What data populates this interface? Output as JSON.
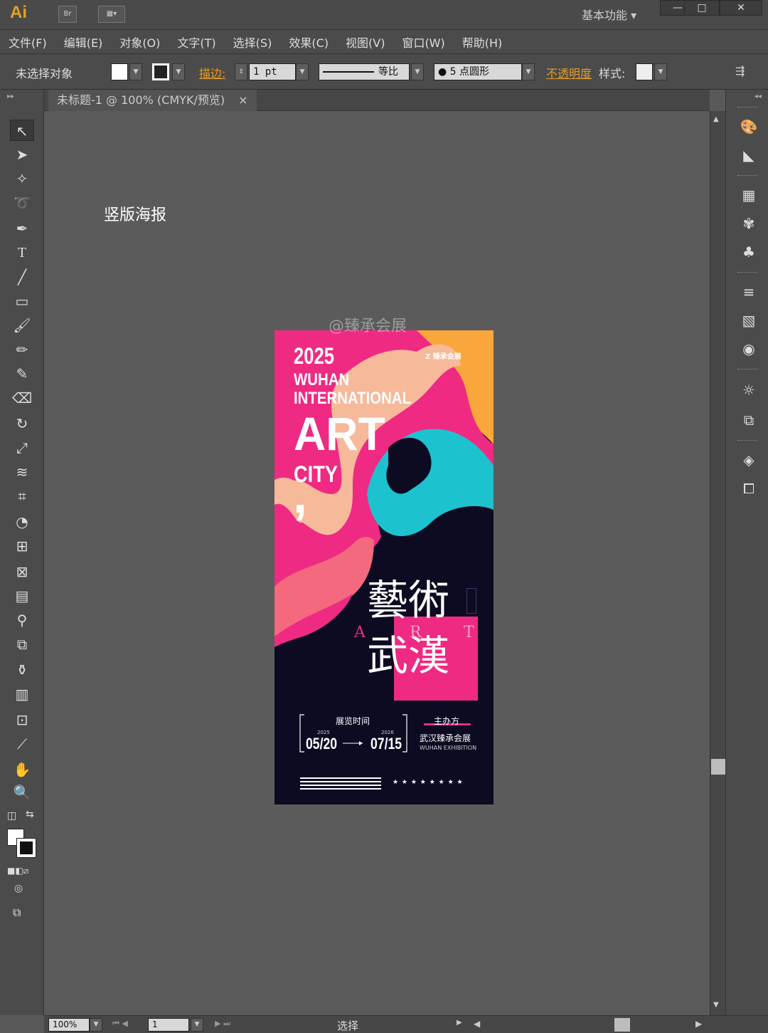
{
  "app": {
    "logo": "Ai",
    "bridge_label": "Br",
    "workspace": "基本功能"
  },
  "window_controls": {
    "minimize": "—",
    "maximize": "□",
    "close": "✕"
  },
  "menu": [
    "文件(F)",
    "编辑(E)",
    "对象(O)",
    "文字(T)",
    "选择(S)",
    "效果(C)",
    "视图(V)",
    "窗口(W)",
    "帮助(H)"
  ],
  "control_bar": {
    "selection": "未选择对象",
    "stroke_label": "描边:",
    "stroke_weight": "1 pt",
    "profile": "等比",
    "brush": "5 点圆形",
    "opacity_label": "不透明度",
    "style_label": "样式:"
  },
  "document_tab": {
    "title": "未标题-1 @ 100% (CMYK/预览)",
    "close": "×"
  },
  "canvas": {
    "label": "竖版海报",
    "watermark": "@臻承会展"
  },
  "poster": {
    "year": "2025",
    "line1": "WUHAN",
    "line2": "INTERNATIONAL",
    "line3": "ART",
    "line4": "CITY",
    "comma": ",",
    "brand": "臻承会展",
    "brand_mark": "Z",
    "cn_line1": "藝術",
    "cn_line2": "武漢",
    "art_letters": [
      "A",
      "R",
      "T"
    ],
    "time_label": "展览时间",
    "start_year": "2025",
    "start_date": "05/20",
    "end_year": "2026",
    "end_date": "07/15",
    "organizer_label": "主办方",
    "organizer_cn": "武汉臻承会展",
    "organizer_en": "WUHAN EXHIBITION",
    "stars": "★ ★ ★ ★ ★ ★ ★ ★",
    "colors": {
      "pink": "#ef2a83",
      "peach": "#f6b99a",
      "orange": "#f9a63a",
      "teal": "#1cc3cf",
      "coral": "#f4697d",
      "navy": "#0c0b22"
    }
  },
  "status": {
    "zoom": "100%",
    "page": "1",
    "mode": "选择"
  },
  "tools_left": [
    "selection-tool-icon",
    "direct-selection-icon",
    "magic-wand-icon",
    "lasso-icon",
    "pen-icon",
    "type-icon",
    "line-icon",
    "rectangle-icon",
    "paintbrush-icon",
    "pencil-icon",
    "blob-brush-icon",
    "eraser-icon",
    "rotate-icon",
    "scale-icon",
    "warp-icon",
    "free-transform-icon",
    "shape-builder-icon",
    "graph-icon",
    "mesh-icon",
    "gradient-icon",
    "eyedropper-icon",
    "blend-icon",
    "symbol-sprayer-icon",
    "column-graph-icon",
    "artboard-icon",
    "slice-icon",
    "hand-icon",
    "zoom-icon"
  ],
  "tools_right": [
    "color-palette-icon",
    "color-guide-icon",
    "swatches-icon",
    "brushes-icon",
    "symbols-icon",
    "stroke-icon",
    "gradient-panel-icon",
    "transparency-icon",
    "appearance-icon",
    "graphic-styles-icon",
    "layers-icon",
    "artboards-icon"
  ]
}
